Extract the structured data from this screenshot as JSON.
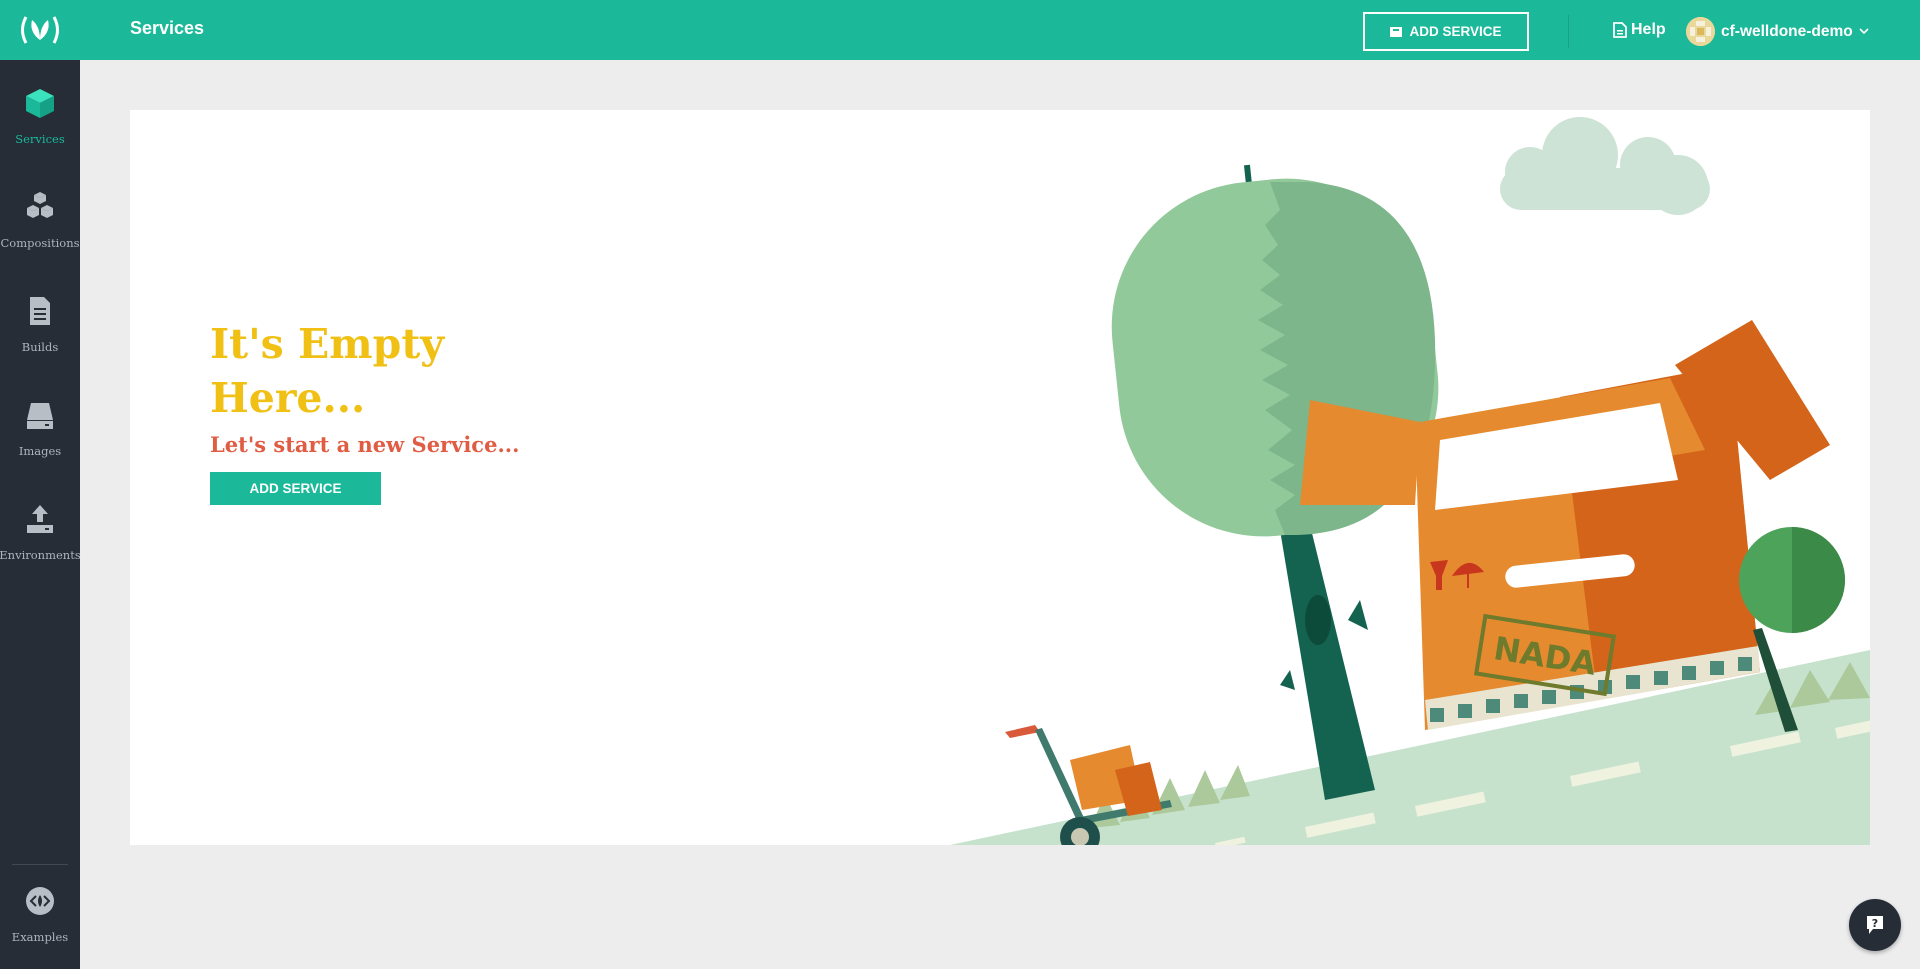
{
  "sidebar": {
    "items": [
      {
        "label": "Services",
        "icon": "cube-icon",
        "active": true
      },
      {
        "label": "Compositions",
        "icon": "cubes-icon"
      },
      {
        "label": "Builds",
        "icon": "document-icon"
      },
      {
        "label": "Images",
        "icon": "drive-icon"
      },
      {
        "label": "Environments",
        "icon": "upload-icon"
      }
    ],
    "examples": {
      "label": "Examples",
      "icon": "code-icon"
    }
  },
  "header": {
    "title": "Services",
    "add_button_label": "ADD SERVICE",
    "help_label": "Help",
    "username": "cf-welldone-demo"
  },
  "empty_state": {
    "title": "It's Empty Here...",
    "subtitle": "Let's start a new Service...",
    "button_label": "ADD SERVICE",
    "stamp_text": "NADA"
  },
  "colors": {
    "accent": "#1bb999",
    "sidebar": "#262d37",
    "title": "#f0c014",
    "subtitle": "#e05d43"
  }
}
